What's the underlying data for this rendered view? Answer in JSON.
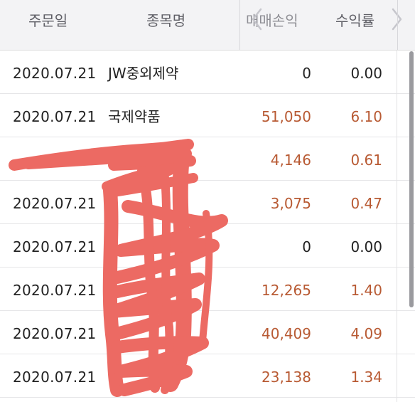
{
  "header": {
    "col_date": "주문일",
    "col_name": "종목명",
    "col_pnl": "매매손익",
    "col_rate": "수익률",
    "nav_left_icon": "chevron-left-icon",
    "nav_right_icon": "chevron-right-icon"
  },
  "rows": [
    {
      "date": "2020.07.21",
      "name": "JW중외제약",
      "pnl": "0",
      "rate": "0.00",
      "positive": false
    },
    {
      "date": "2020.07.21",
      "name": "국제약품",
      "pnl": "51,050",
      "rate": "6.10",
      "positive": true
    },
    {
      "date": "",
      "name": "",
      "pnl": "4,146",
      "rate": "0.61",
      "positive": true
    },
    {
      "date": "2020.07.21",
      "name": "",
      "pnl": "3,075",
      "rate": "0.47",
      "positive": true
    },
    {
      "date": "2020.07.21",
      "name": "",
      "pnl": "0",
      "rate": "0.00",
      "positive": false
    },
    {
      "date": "2020.07.21",
      "name": "",
      "pnl": "12,265",
      "rate": "1.40",
      "positive": true
    },
    {
      "date": "2020.07.21",
      "name": "",
      "pnl": "40,409",
      "rate": "4.09",
      "positive": true
    },
    {
      "date": "2020.07.21",
      "name": "",
      "pnl": "23,138",
      "rate": "1.34",
      "positive": true
    }
  ],
  "colors": {
    "positive": "#b85a33",
    "neutral": "#222222",
    "redaction": "#ec6a63"
  }
}
